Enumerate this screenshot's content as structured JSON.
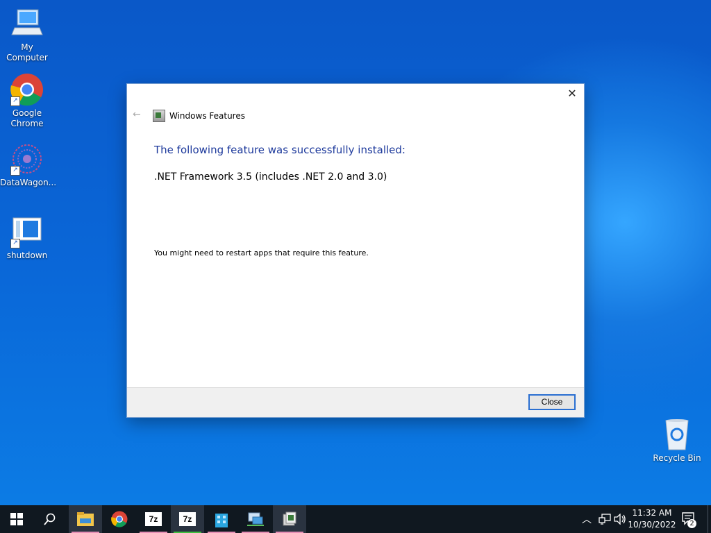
{
  "desktop": {
    "icons": [
      {
        "label": "My Computer"
      },
      {
        "label": "Google Chrome"
      },
      {
        "label": "DataWagon..."
      },
      {
        "label": "shutdown"
      },
      {
        "label": "Recycle Bin"
      }
    ]
  },
  "dialog": {
    "title": "Windows Features",
    "heading": "The following feature was successfully installed:",
    "feature": ".NET Framework 3.5 (includes .NET 2.0 and 3.0)",
    "note": "You might need to restart apps that require this feature.",
    "close_label": "Close"
  },
  "taskbar": {
    "apps": [
      {
        "icon": "file-explorer-icon"
      },
      {
        "icon": "chrome-icon"
      },
      {
        "icon": "7zip-icon",
        "label": "7z"
      },
      {
        "icon": "7zip-icon",
        "label": "7z"
      },
      {
        "icon": "building-app-icon"
      },
      {
        "icon": "network-computer-icon"
      },
      {
        "icon": "windows-features-icon"
      }
    ],
    "time": "11:32 AM",
    "date": "10/30/2022",
    "notification_count": "2"
  },
  "colors": {
    "accent": "#2a6fd1",
    "heading": "#1e3a9c"
  }
}
